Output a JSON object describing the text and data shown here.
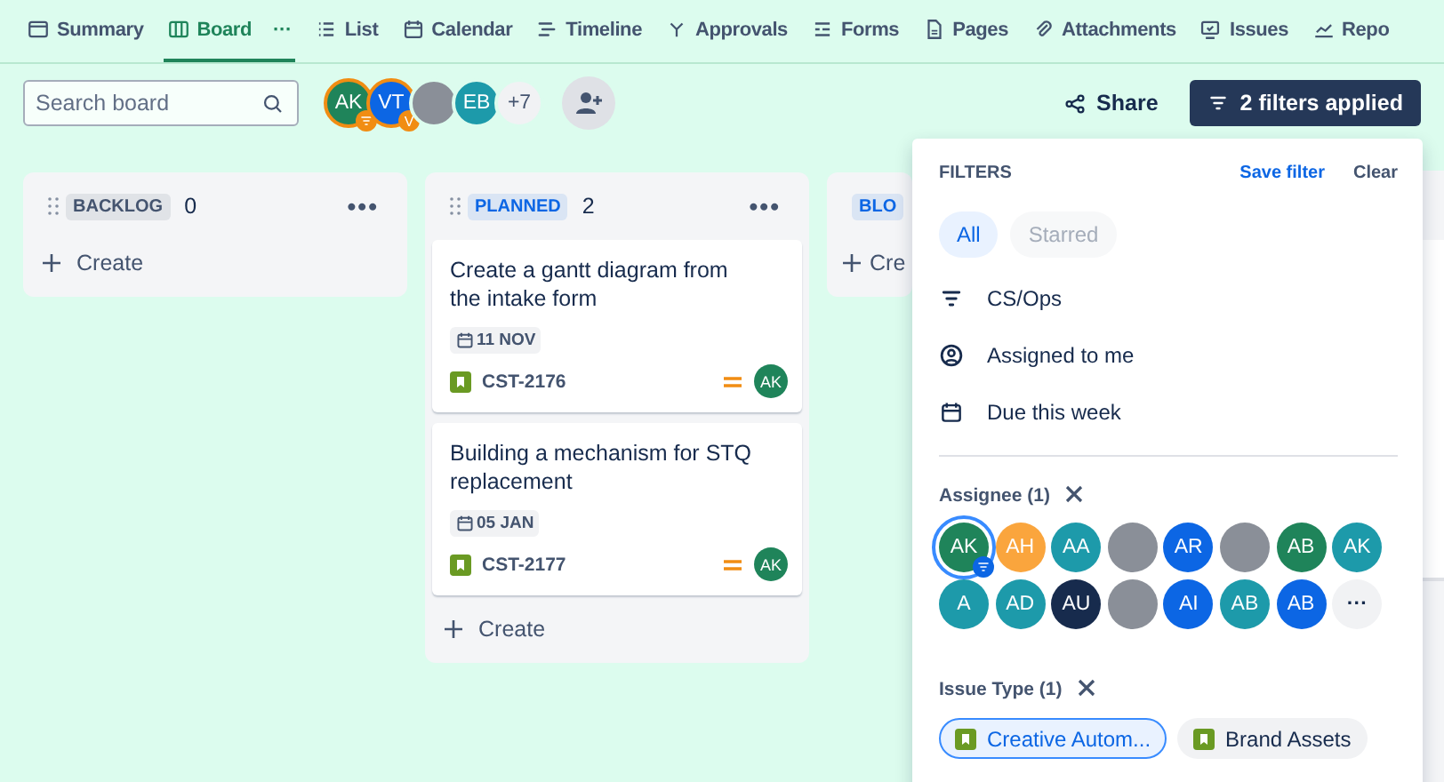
{
  "nav_tabs": [
    {
      "label": "Summary",
      "selected": false
    },
    {
      "label": "Board",
      "selected": true,
      "more": "···"
    },
    {
      "label": "List",
      "selected": false
    },
    {
      "label": "Calendar",
      "selected": false
    },
    {
      "label": "Timeline",
      "selected": false
    },
    {
      "label": "Approvals",
      "selected": false
    },
    {
      "label": "Forms",
      "selected": false
    },
    {
      "label": "Pages",
      "selected": false
    },
    {
      "label": "Attachments",
      "selected": false
    },
    {
      "label": "Issues",
      "selected": false
    },
    {
      "label": "Repo",
      "selected": false
    }
  ],
  "toolbar": {
    "search": {
      "placeholder": "Search board"
    },
    "avatars": [
      {
        "kind": "initials",
        "initials": "AK",
        "color": "#1f845a",
        "filtered": true
      },
      {
        "kind": "initials",
        "initials": "VT",
        "color": "#0c66e4",
        "badge": "V"
      },
      {
        "kind": "photo"
      },
      {
        "kind": "initials",
        "initials": "EB",
        "color": "#1d9aaa"
      },
      {
        "kind": "count",
        "initials": "+7"
      }
    ],
    "share": "Share",
    "filters_button": "2 filters applied"
  },
  "columns": [
    {
      "title": "BACKLOG",
      "count": "0",
      "menu": "•••",
      "color": "#44546f",
      "create": "Create"
    },
    {
      "title": "PLANNED",
      "count": "2",
      "menu": "•••",
      "color": "#0c66e4",
      "create": "Create",
      "cards": [
        {
          "title": "Create a gantt diagram from the intake form",
          "date": "11 NOV",
          "key": "CST-2176",
          "assignee": "AK"
        },
        {
          "title": "Building a mechanism for STQ replacement",
          "date": "05 JAN",
          "key": "CST-2177",
          "assignee": "AK"
        }
      ]
    },
    {
      "title": "BLO",
      "color": "#0c66e4",
      "create": "Cre"
    }
  ],
  "filter_panel": {
    "title": "FILTERS",
    "save": "Save filter",
    "clear": "Clear",
    "scopes": [
      {
        "label": "All",
        "selected": true
      },
      {
        "label": "Starred",
        "selected": false
      }
    ],
    "quick_filters": [
      {
        "label": "CS/Ops"
      },
      {
        "label": "Assigned to me"
      },
      {
        "label": "Due this week"
      }
    ],
    "assignee": {
      "label": "Assignee (1)",
      "people": [
        {
          "kind": "initials",
          "initials": "AK",
          "color": "#1f845a",
          "selected": true
        },
        {
          "kind": "initials",
          "initials": "AH",
          "color": "#faa53d",
          "selected": false
        },
        {
          "kind": "initials",
          "initials": "AA",
          "color": "#1d9aaa",
          "selected": false
        },
        {
          "kind": "photo",
          "selected": false
        },
        {
          "kind": "initials",
          "initials": "AR",
          "color": "#0c66e4",
          "selected": false
        },
        {
          "kind": "photo",
          "selected": false
        },
        {
          "kind": "initials",
          "initials": "AB",
          "color": "#1f845a",
          "selected": false
        },
        {
          "kind": "initials",
          "initials": "AK",
          "color": "#1d9aaa",
          "selected": false
        },
        {
          "kind": "initials",
          "initials": "A",
          "color": "#1d9aaa",
          "selected": false
        },
        {
          "kind": "initials",
          "initials": "AD",
          "color": "#1d9aaa",
          "selected": false
        },
        {
          "kind": "initials",
          "initials": "AU",
          "color": "#172b4d",
          "selected": false
        },
        {
          "kind": "photo",
          "selected": false
        },
        {
          "kind": "initials",
          "initials": "AI",
          "color": "#0c66e4",
          "selected": false
        },
        {
          "kind": "initials",
          "initials": "AB",
          "color": "#1d9aaa",
          "selected": false
        },
        {
          "kind": "initials",
          "initials": "AB",
          "color": "#0c66e4",
          "selected": false
        },
        {
          "kind": "more",
          "initials": "···",
          "selected": false
        }
      ]
    },
    "issue_type": {
      "label": "Issue Type (1)",
      "types": [
        {
          "label": "Creative Autom...",
          "selected": true
        },
        {
          "label": "Brand Assets",
          "selected": false
        }
      ]
    }
  }
}
